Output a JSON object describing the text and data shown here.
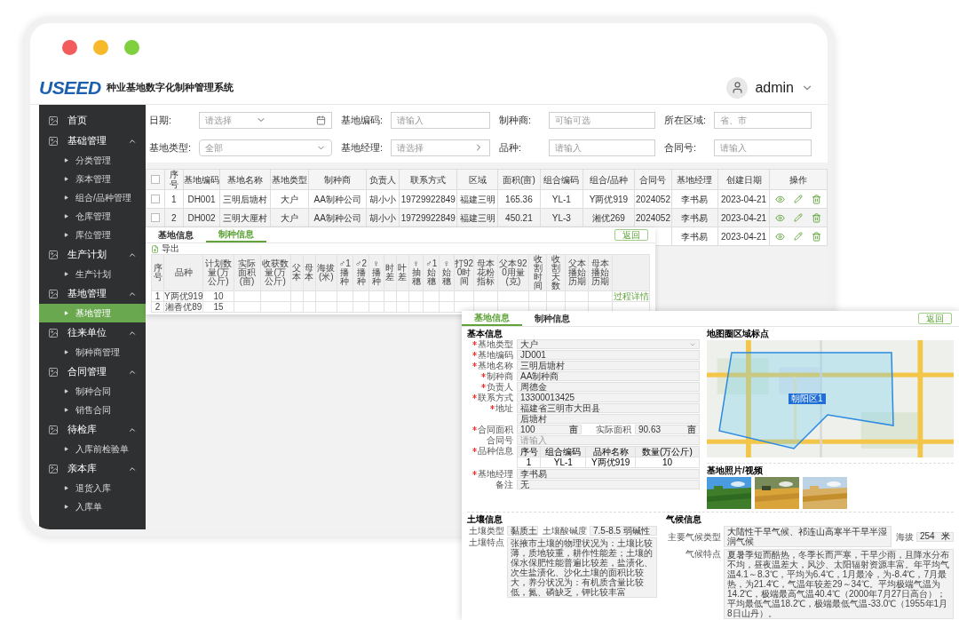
{
  "header": {
    "logo": "USEED",
    "title": "种业基地数字化制种管理系统",
    "user": "admin"
  },
  "sidebar": {
    "items": [
      {
        "kind": "link",
        "label": "首页"
      },
      {
        "kind": "group",
        "label": "基础管理",
        "expanded": true,
        "children": [
          {
            "label": "分类管理",
            "selected": false
          },
          {
            "label": "亲本管理",
            "selected": false
          },
          {
            "label": "组合/品种管理",
            "selected": false
          },
          {
            "label": "仓库管理",
            "selected": false
          },
          {
            "label": "库位管理",
            "selected": false
          }
        ]
      },
      {
        "kind": "group",
        "label": "生产计划",
        "expanded": true,
        "children": [
          {
            "label": "生产计划",
            "selected": false
          }
        ]
      },
      {
        "kind": "group",
        "label": "基地管理",
        "expanded": true,
        "children": [
          {
            "label": "基地管理",
            "selected": true
          }
        ]
      },
      {
        "kind": "group",
        "label": "往来单位",
        "expanded": true,
        "children": [
          {
            "label": "制种商管理",
            "selected": false
          }
        ]
      },
      {
        "kind": "group",
        "label": "合同管理",
        "expanded": true,
        "children": [
          {
            "label": "制种合同",
            "selected": false
          },
          {
            "label": "销售合同",
            "selected": false
          }
        ]
      },
      {
        "kind": "group",
        "label": "待检库",
        "expanded": true,
        "children": [
          {
            "label": "入库前检验单",
            "selected": false
          }
        ]
      },
      {
        "kind": "group",
        "label": "亲本库",
        "expanded": true,
        "children": [
          {
            "label": "退货入库",
            "selected": false
          },
          {
            "label": "入库单",
            "selected": false
          }
        ]
      }
    ]
  },
  "filters": [
    {
      "kind": "date",
      "label": "日期:",
      "placeholder": "请选择"
    },
    {
      "kind": "text",
      "label": "基地编码:",
      "placeholder": "请输入"
    },
    {
      "kind": "text",
      "label": "制种商:",
      "placeholder": "可输可选"
    },
    {
      "kind": "text",
      "label": "所在区域:",
      "placeholder": "省、市"
    },
    {
      "kind": "select",
      "label": "基地类型:",
      "placeholder": "全部"
    },
    {
      "kind": "picker",
      "label": "基地经理:",
      "placeholder": "请选择"
    },
    {
      "kind": "text",
      "label": "品种:",
      "placeholder": "请输入"
    },
    {
      "kind": "text",
      "label": "合同号:",
      "placeholder": "请输入"
    }
  ],
  "table": {
    "select_all_checked": false,
    "columns": [
      "序号",
      "基地编码",
      "基地名称",
      "基地类型",
      "制种商",
      "负责人",
      "联系方式",
      "区域",
      "面积(亩)",
      "组合编码",
      "组合/品种",
      "合同号",
      "基地经理",
      "创建日期",
      "操作"
    ],
    "rows": [
      {
        "checked": false,
        "cells": [
          "1",
          "DH001",
          "三明后塘村",
          "大户",
          "AA制种公司",
          "胡小小",
          "19729922849",
          "福建三明",
          "165.36",
          "YL-1",
          "Y两优919",
          "2024052",
          "李书易",
          "2023-04-21"
        ]
      },
      {
        "checked": false,
        "cells": [
          "2",
          "DH002",
          "三明大厘村",
          "大户",
          "AA制种公司",
          "胡小小",
          "19729922849",
          "福建三明",
          "450.21",
          "YL-3",
          "湘优269",
          "2024052",
          "李书易",
          "2023-04-21"
        ]
      },
      {
        "cells": [
          null,
          null,
          null,
          null,
          null,
          null,
          null,
          null,
          null,
          null,
          null,
          null,
          "李书易",
          "2023-04-21"
        ]
      }
    ]
  },
  "seed_panel": {
    "tabs": [
      {
        "label": "基地信息",
        "selected": false
      },
      {
        "label": "制种信息",
        "selected": true
      }
    ],
    "back_button": "返回",
    "export_button": "导出",
    "columns": [
      "序号",
      "品种",
      "计划数量(万公斤)",
      "实际面积(亩)",
      "收获数量(万公斤)",
      "父本",
      "母本",
      "海拔(米)",
      "♂1播种",
      "♂2播种",
      "♀播种",
      "时差",
      "叶差",
      "♀抽穗",
      "♂1始穗",
      "♀始穗",
      "打920时间",
      "母本花粉指标",
      "父本920用量(克)",
      "收割时间",
      "收割天数",
      "父本播始历期",
      "母本播始历期"
    ],
    "rows": [
      {
        "cells": [
          "1",
          "Y两优919",
          "10"
        ],
        "link": "过程详情"
      },
      {
        "cells": [
          "2",
          "湘香优89",
          "15"
        ]
      }
    ]
  },
  "base_panel": {
    "tabs": [
      {
        "label": "基地信息",
        "selected": true
      },
      {
        "label": "制种信息",
        "selected": false
      }
    ],
    "back_button": "返回",
    "section_title": "基本信息",
    "fields": [
      {
        "kind": "select",
        "label": "基地类型",
        "required": true,
        "value": "大户"
      },
      {
        "kind": "text",
        "label": "基地编码",
        "required": true,
        "value": "JD001"
      },
      {
        "kind": "text",
        "label": "基地名称",
        "required": true,
        "value": "三明后塘村"
      },
      {
        "kind": "text",
        "label": "制种商",
        "required": true,
        "value": "AA制种商"
      },
      {
        "kind": "text",
        "label": "负责人",
        "required": true,
        "value": "周德金"
      },
      {
        "kind": "text",
        "label": "联系方式",
        "required": true,
        "value": "13300013425"
      },
      {
        "kind": "text",
        "label": "地址",
        "required": true,
        "value": "福建省三明市大田县"
      },
      {
        "kind": "text",
        "value": "后塘村"
      },
      {
        "kind": "pair",
        "items": [
          {
            "label": "合同面积",
            "required": true,
            "value": "100",
            "unit": "亩"
          },
          {
            "label": "实际面积",
            "required": false,
            "value": "90.63",
            "unit": "亩"
          }
        ]
      },
      {
        "kind": "text",
        "label": "合同号",
        "required": false,
        "placeholder": "请输入"
      },
      {
        "kind": "table",
        "label": "品种信息",
        "required": true,
        "columns": [
          "序号",
          "组合编码",
          "品种名称",
          "数量(万公斤)"
        ],
        "rows": [
          [
            "1",
            "YL-1",
            "Y两优919",
            "10"
          ]
        ]
      },
      {
        "kind": "text",
        "label": "基地经理",
        "required": true,
        "value": "李书易"
      },
      {
        "kind": "text",
        "label": "备注",
        "required": false,
        "value": "无"
      }
    ],
    "map": {
      "title": "地图圈区域标点",
      "region_label": "朝阳区1"
    },
    "soil": {
      "title": "土壤信息",
      "type_label": "土壤类型",
      "type": "黏质土",
      "ph_label": "土壤酸碱度",
      "ph": "7.5-8.5 弱碱性",
      "feature_label": "土壤特点",
      "feature": "张掖市土壤的物理状况为：土壤比较薄，质地较重，耕作性能差；土壤的保水保肥性能普遍比较差，盐渍化、次生盐渍化、沙化土壤的面积比较大，养分状况为：有机质含量比较低，氮、磷缺乏，钾比较丰富"
    },
    "climate": {
      "title": "气候信息",
      "type_label": "主要气候类型",
      "type": "大陆性干旱气候、祁连山高寒半干旱半湿润气候",
      "altitude_label": "海拔",
      "altitude": "254",
      "altitude_unit": "米",
      "feature_label": "气候特点",
      "feature": "夏暑季短而酷热，冬季长而严寒，干旱少雨，且降水分布不均，昼夜温差大，风沙、太阳辐射资源丰富。年平均气温4.1～8.3℃，平均为6.4℃，1月最冷，为-8.4℃，7月最热，为21.4℃，气温年较差29～34℃。平均极端气温为14.2℃，极端最高气温40.4℃（2000年7月27日高台）；平均最低气温18.2℃，极端最低气温-33.0℃（1955年1月8日山丹）。"
    },
    "photos": {
      "title": "基地照片/视频"
    }
  }
}
